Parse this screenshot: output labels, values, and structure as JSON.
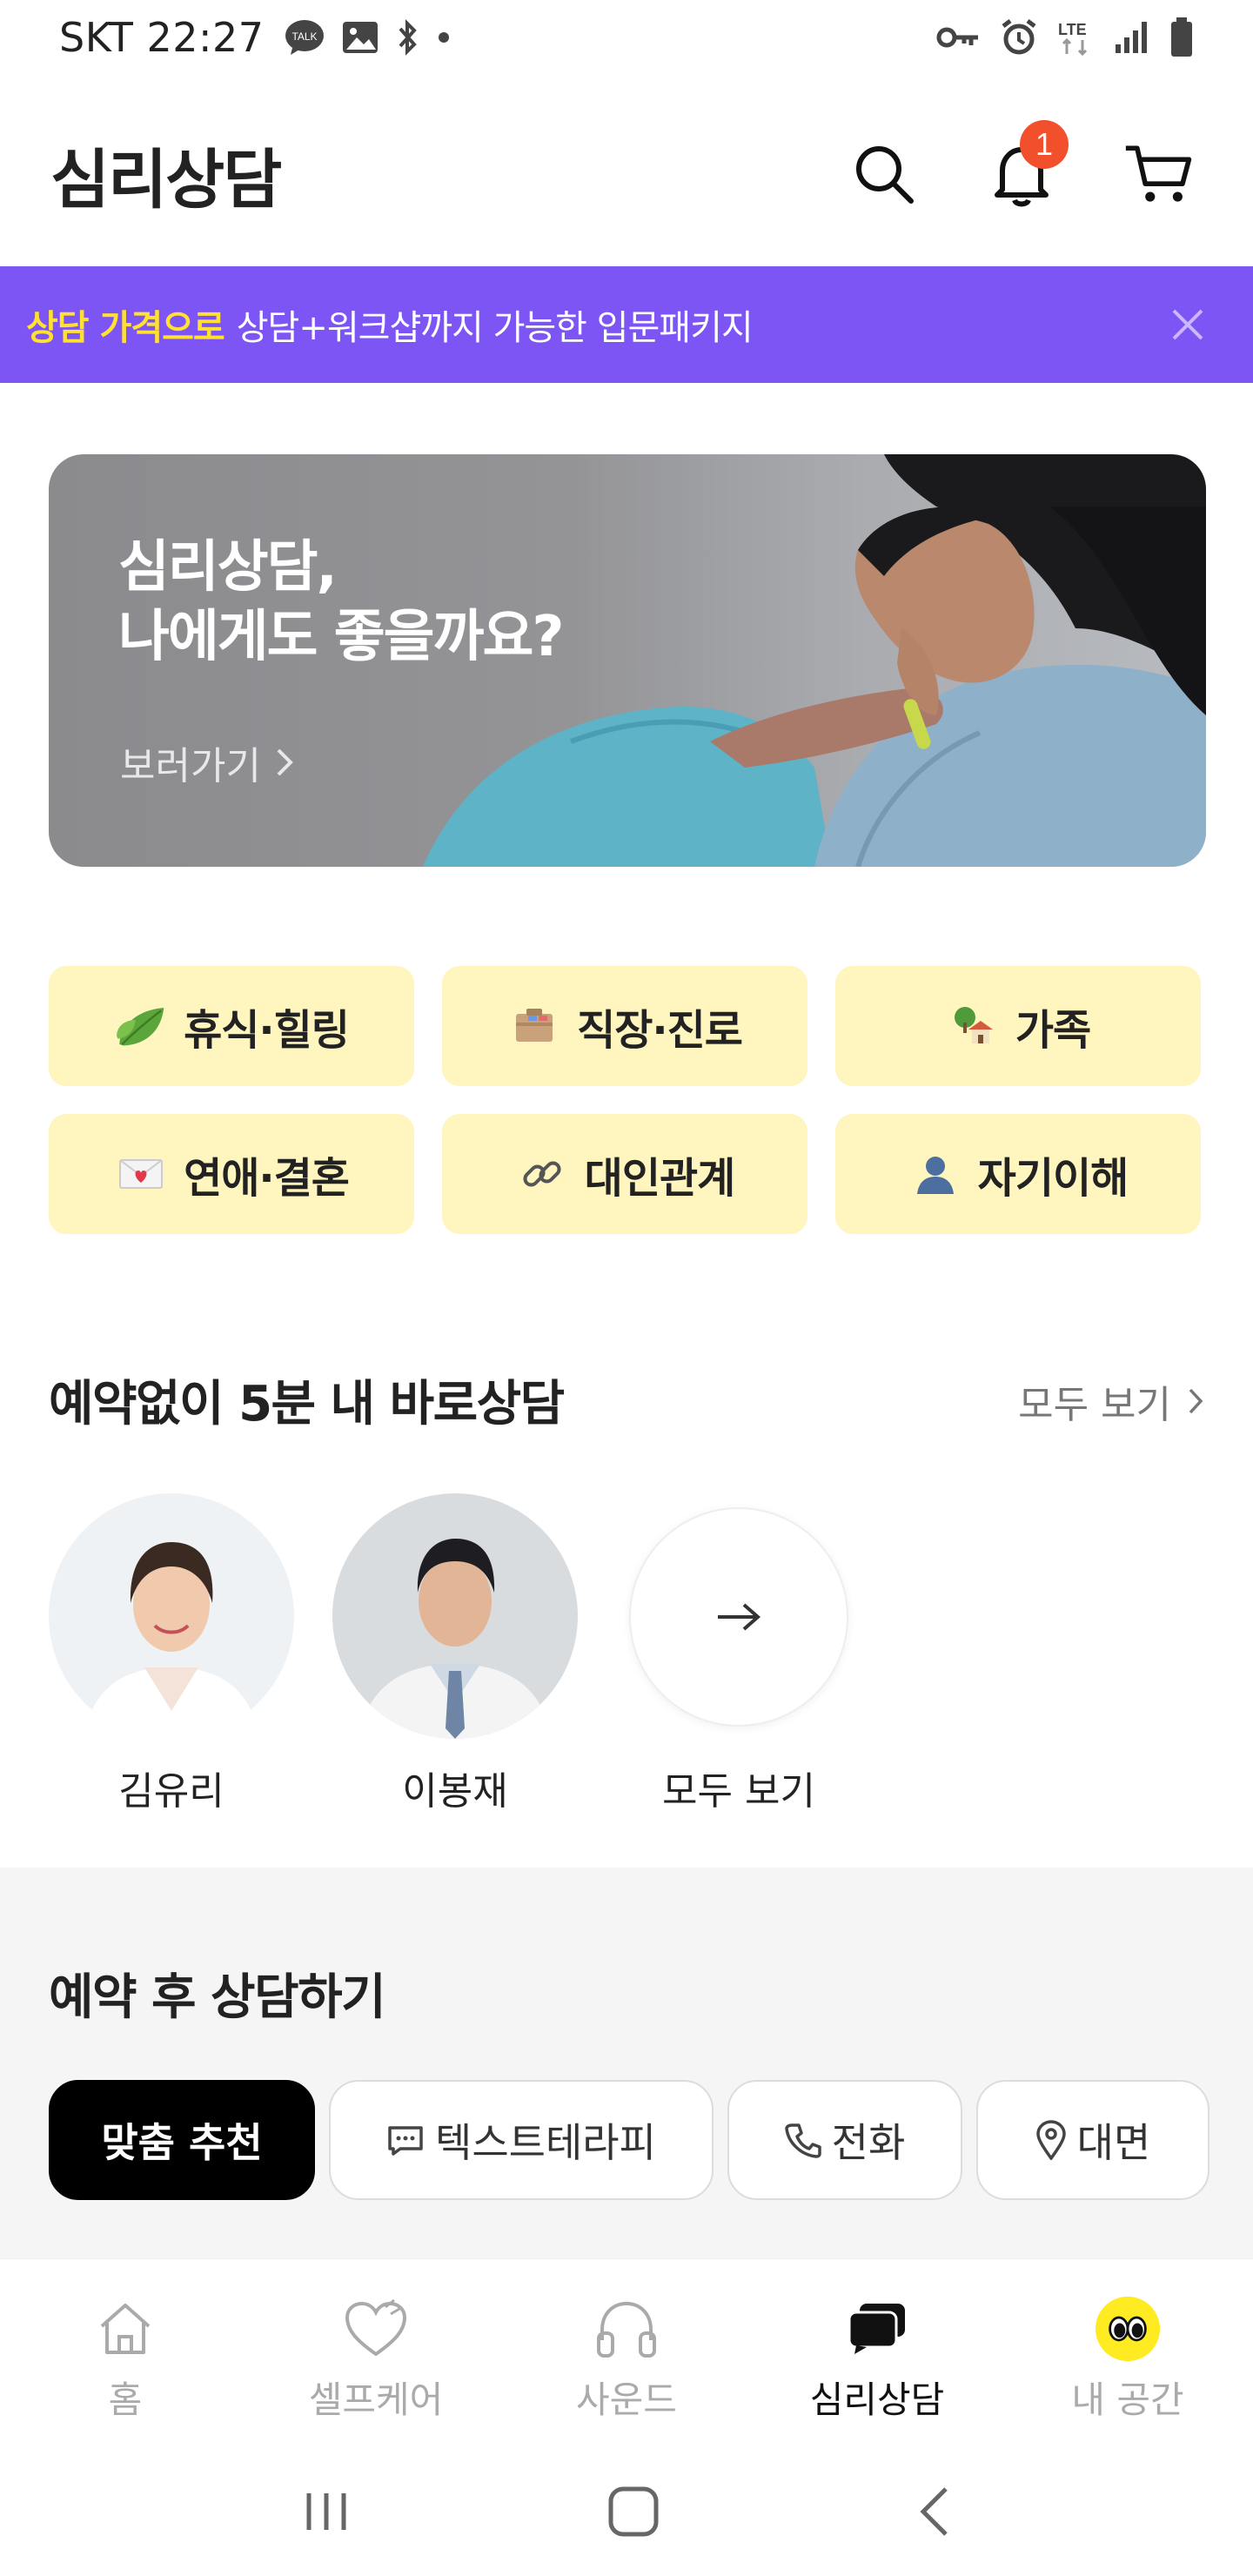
{
  "status_bar": {
    "carrier_time": "SKT 22:27",
    "talk_badge": "TALK",
    "network": "LTE"
  },
  "header": {
    "title": "심리상담",
    "notification_count": "1"
  },
  "promo": {
    "highlight": "상담 가격으로",
    "text": "상담+워크샵까지 가능한 입문패키지"
  },
  "hero": {
    "line1": "심리상담,",
    "line2": "나에게도 좋을까요?",
    "link": "보러가기"
  },
  "categories": [
    {
      "label": "휴식·힐링",
      "icon": "leaf-icon"
    },
    {
      "label": "직장·진로",
      "icon": "briefcase-icon"
    },
    {
      "label": "가족",
      "icon": "house-icon"
    },
    {
      "label": "연애·결혼",
      "icon": "love-letter-icon"
    },
    {
      "label": "대인관계",
      "icon": "link-icon"
    },
    {
      "label": "자기이해",
      "icon": "person-icon"
    }
  ],
  "instant": {
    "title": "예약없이 5분 내 바로상담",
    "see_all": "모두 보기",
    "counselors": [
      {
        "name": "김유리"
      },
      {
        "name": "이봉재"
      }
    ],
    "more_label": "모두 보기"
  },
  "reservation": {
    "title": "예약 후 상담하기",
    "chips": [
      {
        "label": "맞춤 추천",
        "active": true
      },
      {
        "label": "텍스트테라피",
        "icon": "chat-icon"
      },
      {
        "label": "전화",
        "icon": "phone-icon"
      },
      {
        "label": "대면",
        "icon": "location-icon"
      }
    ]
  },
  "bottom_nav": [
    {
      "label": "홈",
      "icon": "home-icon"
    },
    {
      "label": "셀프케어",
      "icon": "heart-icon"
    },
    {
      "label": "사운드",
      "icon": "headphones-icon"
    },
    {
      "label": "심리상담",
      "icon": "chat-bubbles-icon",
      "active": true
    },
    {
      "label": "내 공간",
      "icon": "eyes-avatar-icon"
    }
  ],
  "colors": {
    "promo_bg": "#7d55f5",
    "promo_highlight": "#ffe033",
    "category_bg": "#fff5bf",
    "badge": "#f2502d"
  }
}
